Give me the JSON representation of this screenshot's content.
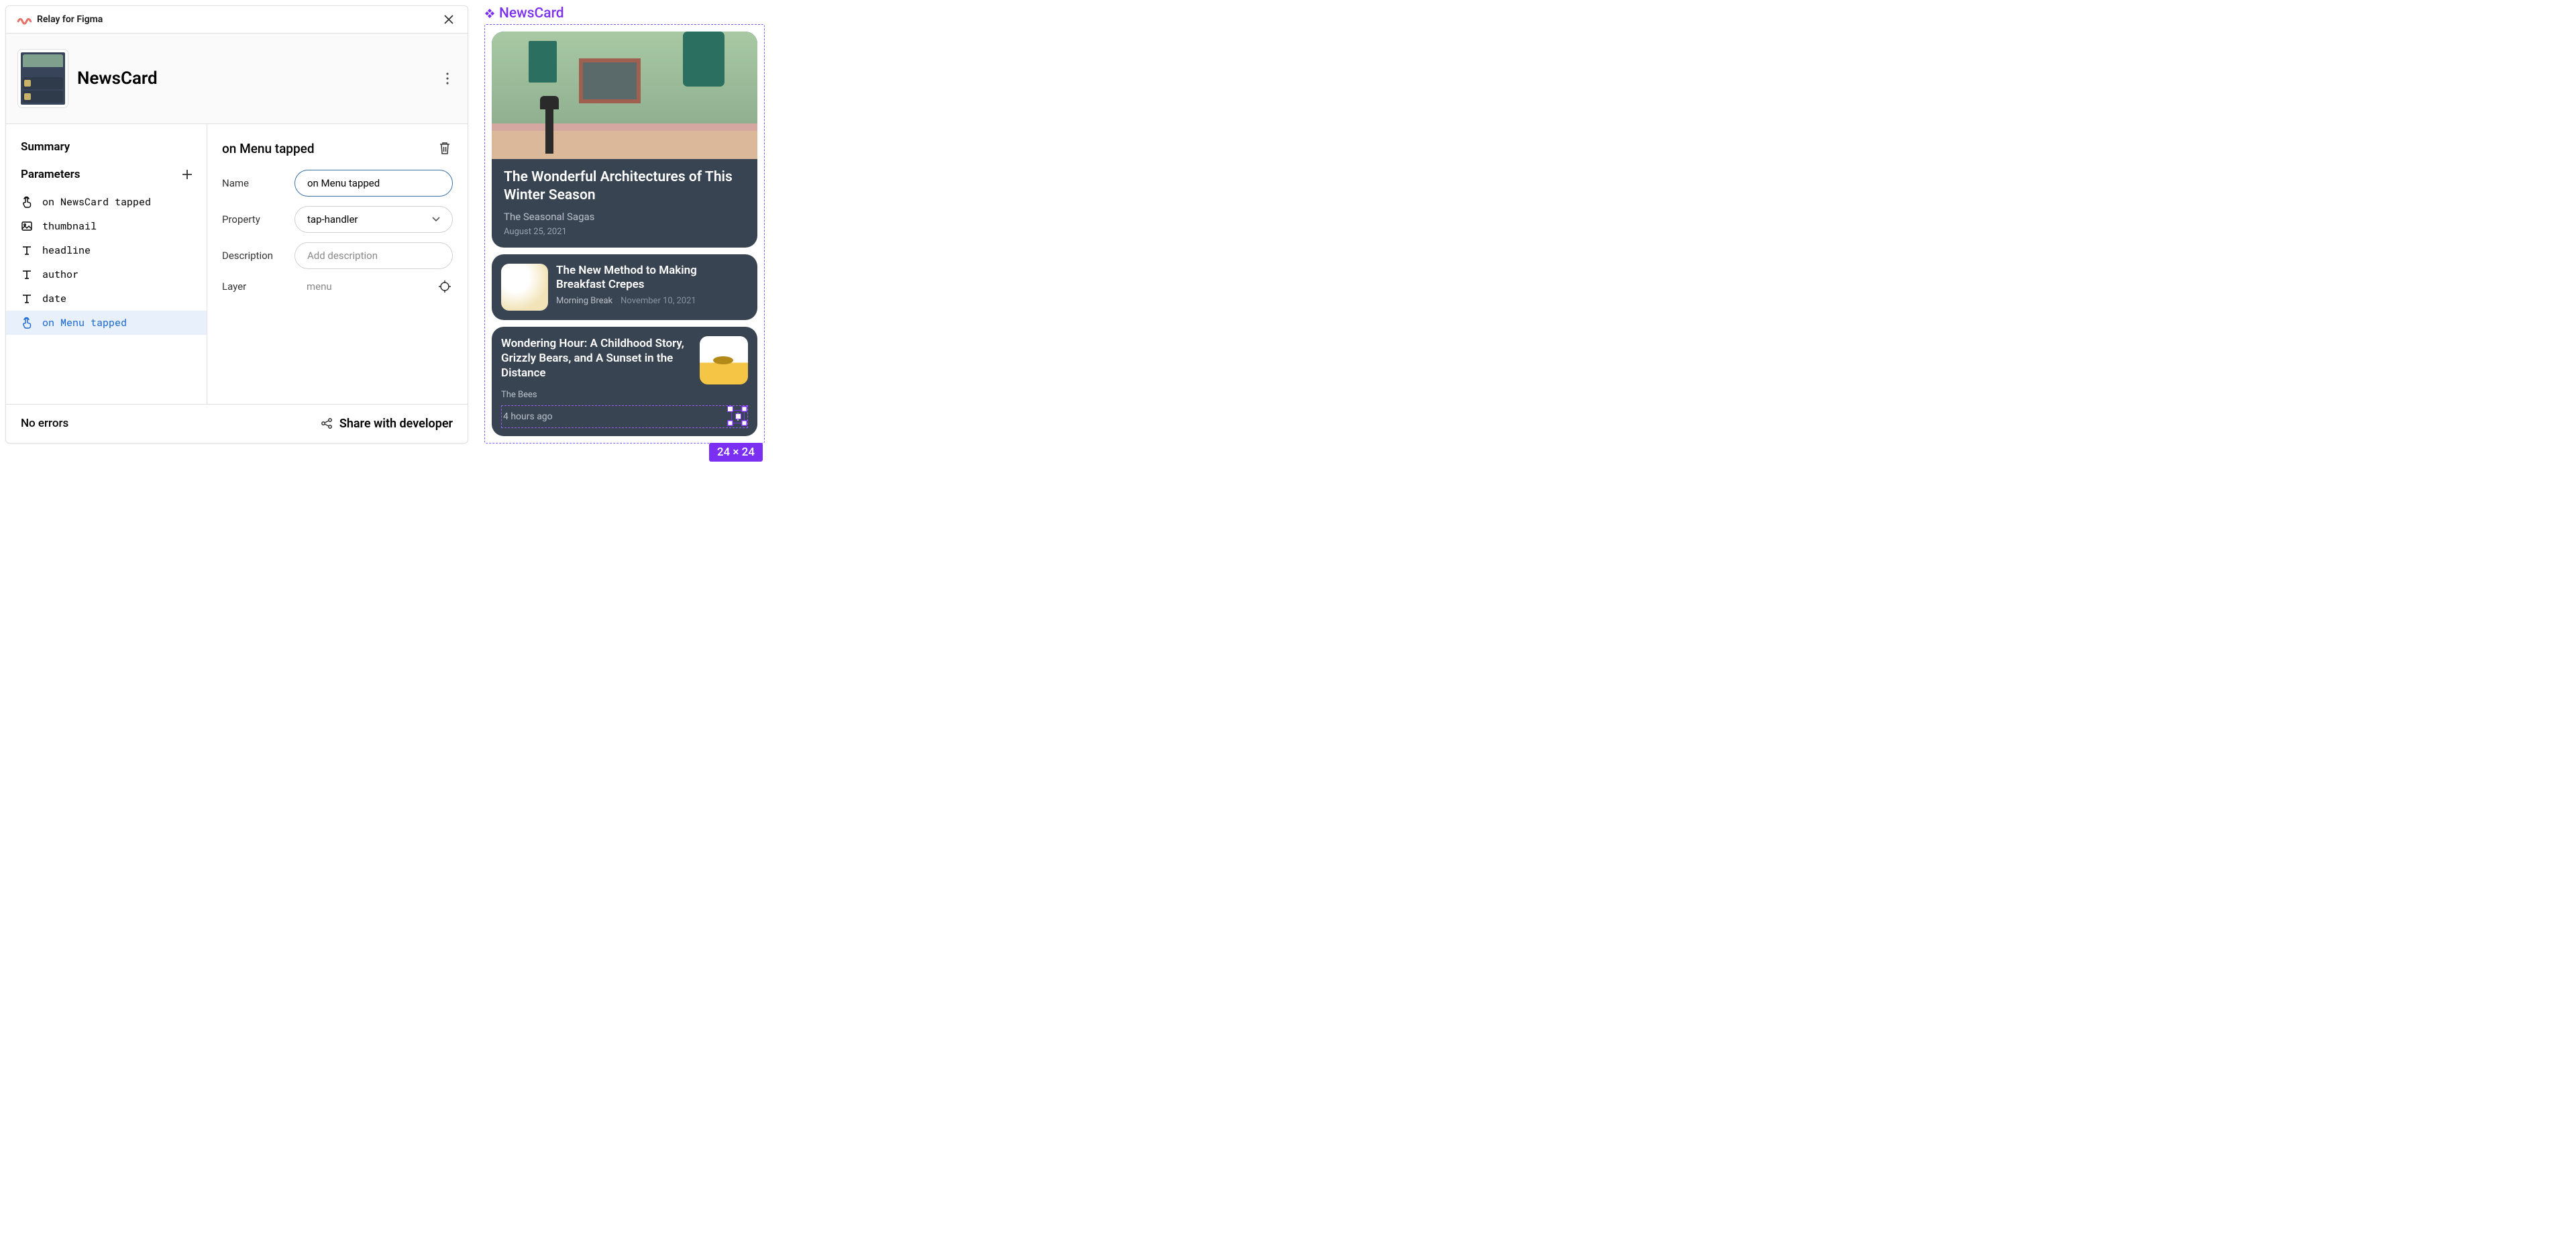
{
  "panel": {
    "app_title": "Relay for Figma",
    "component_name": "NewsCard",
    "sections": {
      "summary": "Summary",
      "parameters": "Parameters"
    },
    "parameters": [
      {
        "icon": "tap",
        "label": "on NewsCard tapped"
      },
      {
        "icon": "image",
        "label": "thumbnail"
      },
      {
        "icon": "text",
        "label": "headline"
      },
      {
        "icon": "text",
        "label": "author"
      },
      {
        "icon": "text",
        "label": "date"
      },
      {
        "icon": "tap",
        "label": "on Menu tapped",
        "selected": true
      }
    ],
    "detail": {
      "title": "on Menu tapped",
      "fields": {
        "name": {
          "label": "Name",
          "value": "on Menu tapped"
        },
        "property": {
          "label": "Property",
          "value": "tap-handler"
        },
        "description": {
          "label": "Description",
          "placeholder": "Add description"
        },
        "layer": {
          "label": "Layer",
          "value": "menu"
        }
      }
    },
    "footer": {
      "status": "No errors",
      "share": "Share with developer"
    }
  },
  "canvas": {
    "frame_label": "NewsCard",
    "selection_dims": "24 × 24",
    "cards": {
      "hero": {
        "title": "The Wonderful Architectures of This Winter Season",
        "author": "The Seasonal Sagas",
        "date": "August 25, 2021"
      },
      "row": {
        "title": "The New Method to Making Breakfast Crepes",
        "author": "Morning Break",
        "date": "November 10, 2021"
      },
      "third": {
        "title": "Wondering Hour: A Childhood Story, Grizzly Bears, and A Sunset in the Distance",
        "author": "The Bees",
        "time": "4 hours ago"
      }
    }
  }
}
